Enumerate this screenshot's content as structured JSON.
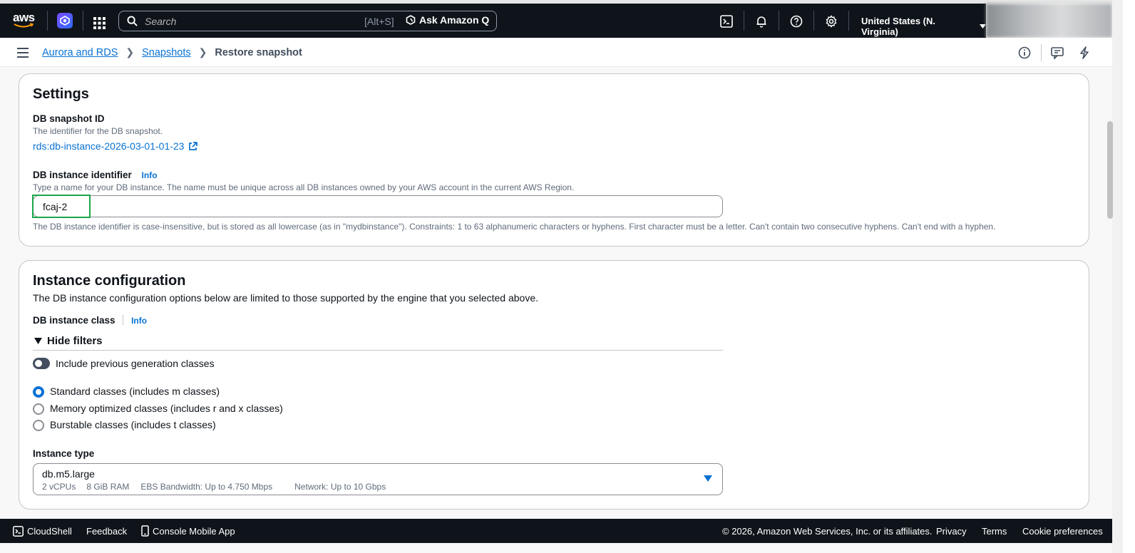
{
  "topbar": {
    "logo_text": "aws",
    "search_placeholder": "Search",
    "search_shortcut": "[Alt+S]",
    "ask_q_label": "Ask Amazon Q",
    "region_label": "United States (N. Virginia)",
    "icons": [
      "cloudshell-icon",
      "bell-icon",
      "help-icon",
      "gear-icon"
    ]
  },
  "breadcrumb": {
    "items": [
      {
        "label": "Aurora and RDS"
      },
      {
        "label": "Snapshots"
      },
      {
        "label": "Restore snapshot"
      }
    ]
  },
  "settings": {
    "title": "Settings",
    "snapshot_id_label": "DB snapshot ID",
    "snapshot_id_desc": "The identifier for the DB snapshot.",
    "snapshot_id_value": "rds:db-instance-2026-03-01-01-23",
    "instance_identifier_label": "DB instance identifier",
    "info_label": "Info",
    "instance_identifier_desc": "Type a name for your DB instance. The name must be unique across all DB instances owned by your AWS account in the current AWS Region.",
    "instance_identifier_value": "fcaj-2",
    "instance_identifier_constraint": "The DB instance identifier is case-insensitive, but is stored as all lowercase (as in \"mydbinstance\"). Constraints: 1 to 63 alphanumeric characters or hyphens. First character must be a letter. Can't contain two consecutive hyphens. Can't end with a hyphen."
  },
  "instance_config": {
    "title": "Instance configuration",
    "subtitle": "The DB instance configuration options below are limited to those supported by the engine that you selected above.",
    "class_label": "DB instance class",
    "info_label": "Info",
    "hide_filters_label": "Hide filters",
    "toggle_label": "Include previous generation classes",
    "toggle_on": false,
    "radios": [
      {
        "label": "Standard classes (includes m classes)",
        "selected": true
      },
      {
        "label": "Memory optimized classes (includes r and x classes)",
        "selected": false
      },
      {
        "label": "Burstable classes (includes t classes)",
        "selected": false
      }
    ],
    "instance_type_label": "Instance type",
    "instance_type_value": "db.m5.large",
    "instance_type_specs": {
      "vcpus": "2 vCPUs",
      "ram": "8 GiB RAM",
      "ebs": "EBS Bandwidth: Up to 4.750 Mbps",
      "network": "Network: Up to 10 Gbps"
    }
  },
  "footer": {
    "cloudshell": "CloudShell",
    "feedback": "Feedback",
    "mobile_app": "Console Mobile App",
    "copyright": "© 2026, Amazon Web Services, Inc. or its affiliates.",
    "privacy": "Privacy",
    "terms": "Terms",
    "cookies": "Cookie preferences"
  },
  "colors": {
    "nav_bg": "#0f141a",
    "link": "#0972d3",
    "focus": "#1aa64a"
  }
}
